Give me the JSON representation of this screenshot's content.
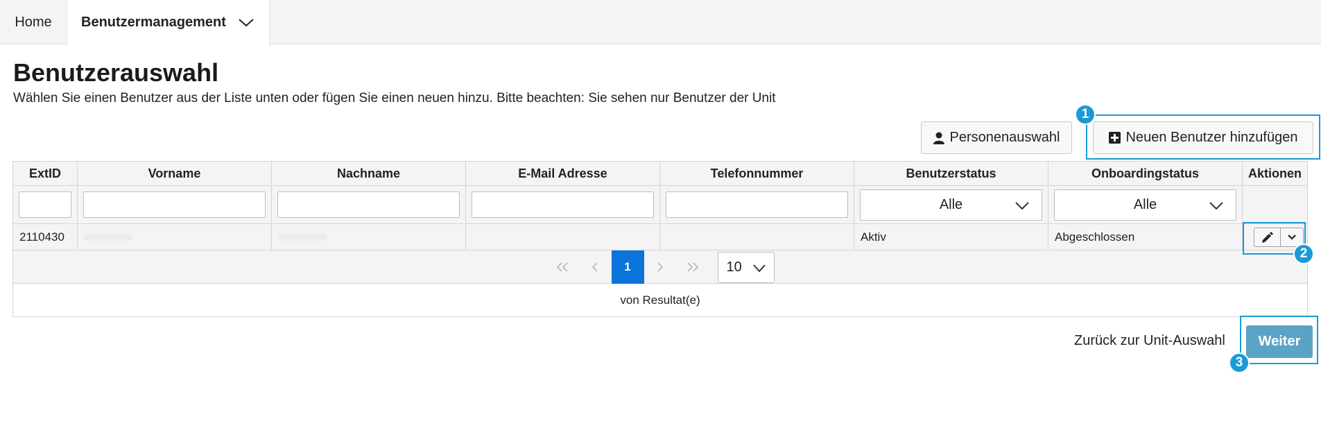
{
  "nav": {
    "home": "Home",
    "user_management": "Benutzermanagement"
  },
  "page": {
    "title": "Benutzerauswahl",
    "subtitle": "Wählen Sie einen Benutzer aus der Liste unten oder fügen Sie einen neuen hinzu. Bitte beachten: Sie sehen nur Benutzer der Unit"
  },
  "toolbar": {
    "person_select": "Personenauswahl",
    "add_user": "Neuen Benutzer hinzufügen"
  },
  "table": {
    "columns": [
      "ExtID",
      "Vorname",
      "Nachname",
      "E-Mail Adresse",
      "Telefonnummer",
      "Benutzerstatus",
      "Onboardingstatus",
      "Aktionen"
    ],
    "filters": {
      "benutzerstatus": "Alle",
      "onboardingstatus": "Alle"
    },
    "rows": [
      {
        "extid": "2110430",
        "vorname": "",
        "nachname": "",
        "email": "",
        "telefon": "",
        "benutzerstatus": "Aktiv",
        "onboardingstatus": "Abgeschlossen"
      }
    ],
    "pager": {
      "current_page": "1",
      "page_size": "10"
    },
    "results_text": "von Resultat(e)"
  },
  "footer": {
    "back": "Zurück zur Unit-Auswahl",
    "next": "Weiter"
  },
  "annotations": [
    "1",
    "2",
    "3"
  ],
  "colors": {
    "accent": "#1a9ad6",
    "pager_active": "#0a74d9",
    "next_button": "#5ba3c4"
  }
}
